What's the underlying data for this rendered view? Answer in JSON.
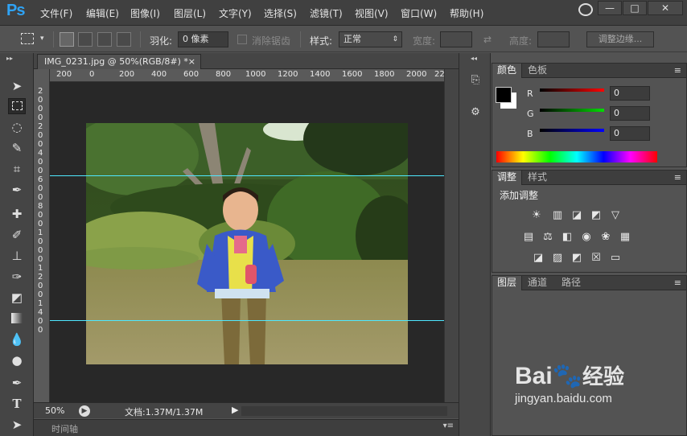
{
  "app": {
    "logo": "Ps"
  },
  "menu": [
    "文件(F)",
    "编辑(E)",
    "图像(I)",
    "图层(L)",
    "文字(Y)",
    "选择(S)",
    "滤镜(T)",
    "视图(V)",
    "窗口(W)",
    "帮助(H)"
  ],
  "window_buttons": {
    "minimize": "—",
    "maximize": "□",
    "close": "✕"
  },
  "options": {
    "feather_label": "羽化:",
    "feather_value": "0 像素",
    "antialias_label": "消除锯齿",
    "style_label": "样式:",
    "style_value": "正常",
    "width_label": "宽度:",
    "height_label": "高度:",
    "refine_button": "调整边缘..."
  },
  "document": {
    "tab_title": "IMG_0231.jpg @ 50%(RGB/8#) *",
    "close": "×",
    "zoom": "50%",
    "doc_info": "文档:1.37M/1.37M"
  },
  "ruler": {
    "top_ticks": [
      "200",
      "0",
      "200",
      "400",
      "600",
      "800",
      "1000",
      "1200",
      "1400",
      "1600",
      "1800",
      "2000",
      "22"
    ],
    "left_ticks": [
      "2",
      "0",
      "0",
      "0",
      "2",
      "0",
      "0",
      "4",
      "0",
      "0",
      "6",
      "0",
      "0",
      "8",
      "0",
      "0",
      "1",
      "0",
      "0",
      "0",
      "1",
      "2",
      "0",
      "0",
      "1",
      "4",
      "0",
      "0"
    ]
  },
  "timeline": {
    "label": "时间轴"
  },
  "color_panel": {
    "tabs": [
      "颜色",
      "色板"
    ],
    "channels": [
      {
        "name": "R",
        "value": "0",
        "color": "#ff0000"
      },
      {
        "name": "G",
        "value": "0",
        "color": "#00cc00"
      },
      {
        "name": "B",
        "value": "0",
        "color": "#0000ff"
      }
    ],
    "foreground": "#000000",
    "background": "#ffffff"
  },
  "adjust_panel": {
    "tabs": [
      "调整",
      "样式"
    ],
    "heading": "添加调整",
    "icons_row1": [
      "brightness-icon",
      "levels-icon",
      "curves-icon",
      "exposure-icon",
      "vibrance-icon"
    ],
    "icons_row2": [
      "hue-saturation-icon",
      "color-balance-icon",
      "black-white-icon",
      "photo-filter-icon",
      "channel-mixer-icon",
      "color-lookup-icon"
    ],
    "icons_row3": [
      "invert-icon",
      "posterize-icon",
      "threshold-icon",
      "selective-color-icon",
      "gradient-map-icon"
    ]
  },
  "layers_panel": {
    "tabs": [
      "图层",
      "通道",
      "路径"
    ]
  },
  "watermark": {
    "brand": "Bai",
    "brand2": "经验",
    "url": "jingyan.baidu.com"
  }
}
